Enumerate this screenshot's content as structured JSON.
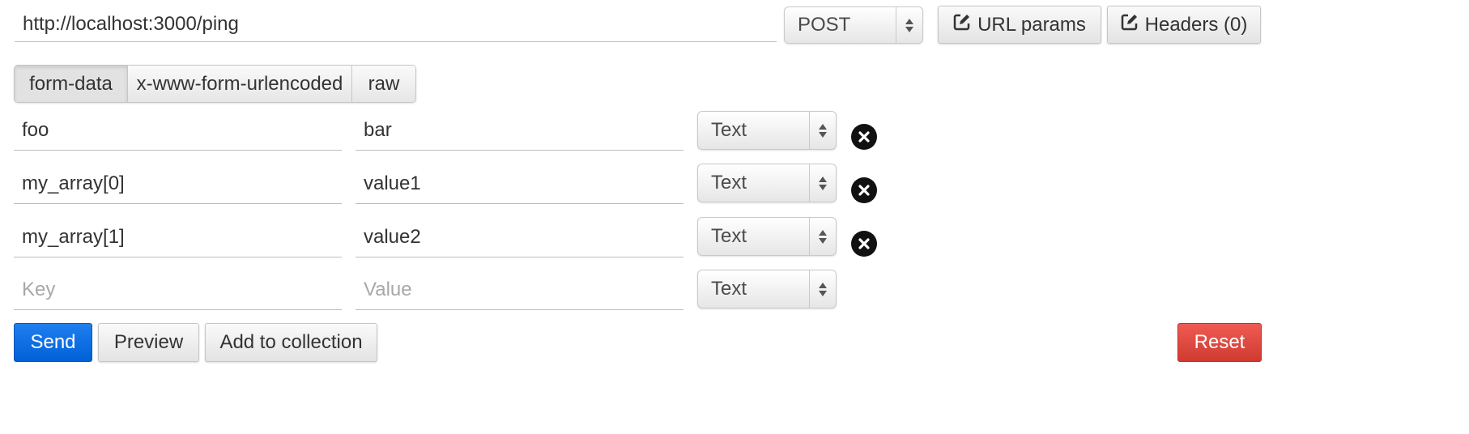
{
  "request": {
    "url": "http://localhost:3000/ping",
    "method": "POST",
    "url_params_label": "URL params",
    "headers_label": "Headers (0)"
  },
  "body_tabs": [
    "form-data",
    "x-www-form-urlencoded",
    "raw"
  ],
  "active_tab": "form-data",
  "form_rows": [
    {
      "key": "foo",
      "value": "bar",
      "type": "Text"
    },
    {
      "key": "my_array[0]",
      "value": "value1",
      "type": "Text"
    },
    {
      "key": "my_array[1]",
      "value": "value2",
      "type": "Text"
    }
  ],
  "new_row": {
    "key_placeholder": "Key",
    "value_placeholder": "Value",
    "type": "Text"
  },
  "actions": {
    "send": "Send",
    "preview": "Preview",
    "add_to_collection": "Add to collection",
    "reset": "Reset"
  },
  "colors": {
    "send": "#0060d6",
    "reset": "#d9443b"
  },
  "icons": {
    "edit": "edit-icon",
    "delete": "close-circle-icon"
  }
}
